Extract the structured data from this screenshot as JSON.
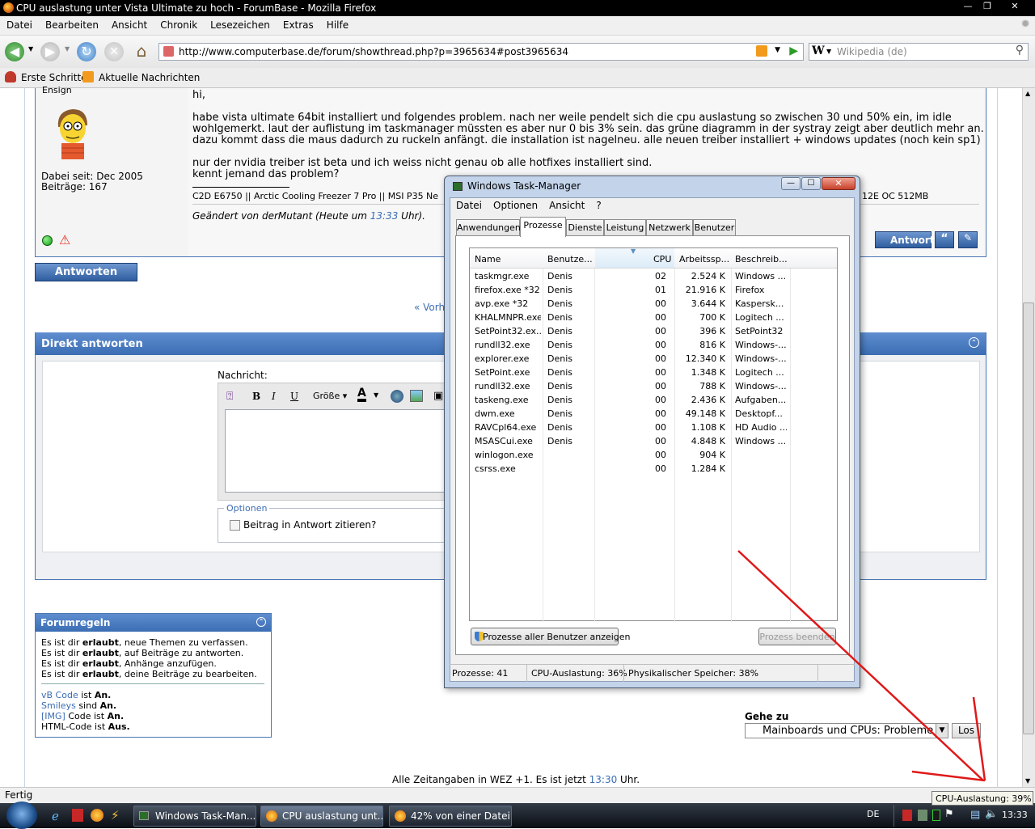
{
  "browser": {
    "title": "CPU auslastung unter Vista Ultimate zu hoch - ForumBase - Mozilla Firefox",
    "menu": [
      "Datei",
      "Bearbeiten",
      "Ansicht",
      "Chronik",
      "Lesezeichen",
      "Extras",
      "Hilfe"
    ],
    "url": "http://www.computerbase.de/forum/showthread.php?p=3965634#post3965634",
    "search_placeholder": "Wikipedia (de)",
    "bookmarks": [
      "Erste Schritte",
      "Aktuelle Nachrichten"
    ],
    "status": "Fertig"
  },
  "post": {
    "rank": "Ensign",
    "joined": "Dabei seit: Dec 2005",
    "posts": "Beiträge: 167",
    "greeting": "hi,",
    "para1_l1": "habe vista ultimate 64bit installiert und folgendes problem. nach ner weile pendelt sich die cpu auslastung so zwischen 30 und 50% ein, im idle",
    "para1_l2": "wohlgemerkt. laut der auflistung im taskmanager müssten es aber nur 0 bis 3% sein. das grüne diagramm in der systray zeigt aber deutlich mehr an.",
    "para1_l3": "dazu kommt dass die maus dadurch zu ruckeln anfängt. die installation ist nagelneu. alle neuen treiber installiert + windows updates (noch kein sp1)",
    "para2_l1": "nur der nvidia treiber ist beta und ich weiss nicht genau ob alle hotfixes installiert sind.",
    "para2_l2": "kennt jemand das problem?",
    "signature_left": "C2D E6750 || Arctic Cooling Freezer 7 Pro || MSI P35 Ne",
    "signature_right": "12E OC 512MB",
    "edited_prefix": "Geändert von derMutant (Heute um ",
    "edited_time": "13:33",
    "edited_suffix": " Uhr).",
    "reply_button": "Antwort"
  },
  "reply_button": "Antworten",
  "prev_link": "« Vorh",
  "quick_reply": {
    "title": "Direkt antworten",
    "message_label": "Nachricht:",
    "size_label": "Größe",
    "options_label": "Optionen",
    "quote_label": "Beitrag in Antwort zitieren?"
  },
  "rules": {
    "title": "Forumregeln",
    "lines": [
      {
        "pre": "Es ist dir ",
        "bold": "erlaubt",
        "post": ", neue Themen zu verfassen."
      },
      {
        "pre": "Es ist dir ",
        "bold": "erlaubt",
        "post": ", auf Beiträge zu antworten."
      },
      {
        "pre": "Es ist dir ",
        "bold": "erlaubt",
        "post": ", Anhänge anzufügen."
      },
      {
        "pre": "Es ist dir ",
        "bold": "erlaubt",
        "post": ", deine Beiträge zu bearbeiten."
      }
    ],
    "codes": [
      {
        "name": "vB Code",
        "mid": " ist ",
        "state": "An."
      },
      {
        "name": "Smileys",
        "mid": " sind ",
        "state": "An."
      },
      {
        "name": "[IMG]",
        "mid": " Code ist ",
        "state": "An."
      },
      {
        "name": "HTML-Code",
        "mid": " ist ",
        "state": "Aus."
      }
    ]
  },
  "goto": {
    "label": "Gehe zu",
    "selected": "Mainboards und CPUs: Probleme",
    "button": "Los"
  },
  "footer": {
    "pre": "Alle Zeitangaben in WEZ +1. Es ist jetzt ",
    "time": "13:30",
    "post": " Uhr."
  },
  "taskmanager": {
    "title": "Windows Task-Manager",
    "menu": [
      "Datei",
      "Optionen",
      "Ansicht",
      "?"
    ],
    "tabs": [
      "Anwendungen",
      "Prozesse",
      "Dienste",
      "Leistung",
      "Netzwerk",
      "Benutzer"
    ],
    "active_tab": "Prozesse",
    "columns": [
      "Name",
      "Benutze...",
      "CPU",
      "Arbeitssp...",
      "Beschreib..."
    ],
    "rows": [
      [
        "taskmgr.exe",
        "Denis",
        "02",
        "2.524 K",
        "Windows ..."
      ],
      [
        "firefox.exe *32",
        "Denis",
        "01",
        "21.916 K",
        "Firefox"
      ],
      [
        "avp.exe *32",
        "Denis",
        "00",
        "3.644 K",
        "Kaspersk..."
      ],
      [
        "KHALMNPR.exe",
        "Denis",
        "00",
        "700 K",
        "Logitech ..."
      ],
      [
        "SetPoint32.ex...",
        "Denis",
        "00",
        "396 K",
        "SetPoint32"
      ],
      [
        "rundll32.exe",
        "Denis",
        "00",
        "816 K",
        "Windows-..."
      ],
      [
        "explorer.exe",
        "Denis",
        "00",
        "12.340 K",
        "Windows-..."
      ],
      [
        "SetPoint.exe",
        "Denis",
        "00",
        "1.348 K",
        "Logitech ..."
      ],
      [
        "rundll32.exe",
        "Denis",
        "00",
        "788 K",
        "Windows-..."
      ],
      [
        "taskeng.exe",
        "Denis",
        "00",
        "2.436 K",
        "Aufgaben..."
      ],
      [
        "dwm.exe",
        "Denis",
        "00",
        "49.148 K",
        "Desktopf..."
      ],
      [
        "RAVCpl64.exe",
        "Denis",
        "00",
        "1.108 K",
        "HD Audio ..."
      ],
      [
        "MSASCui.exe",
        "Denis",
        "00",
        "4.848 K",
        "Windows ..."
      ],
      [
        "winlogon.exe",
        "",
        "00",
        "904 K",
        ""
      ],
      [
        "csrss.exe",
        "",
        "00",
        "1.284 K",
        ""
      ]
    ],
    "show_all_button": "Prozesse aller Benutzer anzeigen",
    "end_button": "Prozess beenden",
    "status_processes": "Prozesse: 41",
    "status_cpu": "CPU-Auslastung: 36%",
    "status_memory": "Physikalischer Speicher: 38%"
  },
  "taskbar": {
    "buttons": [
      "Windows Task-Man...",
      "CPU auslastung unt...",
      "42% von einer Datei ..."
    ],
    "lang": "DE",
    "clock": "13:33",
    "tooltip": "CPU-Auslastung: 39%"
  },
  "colors": {
    "forum_blue": "#3b6db3",
    "arrow_red": "#e01818"
  }
}
